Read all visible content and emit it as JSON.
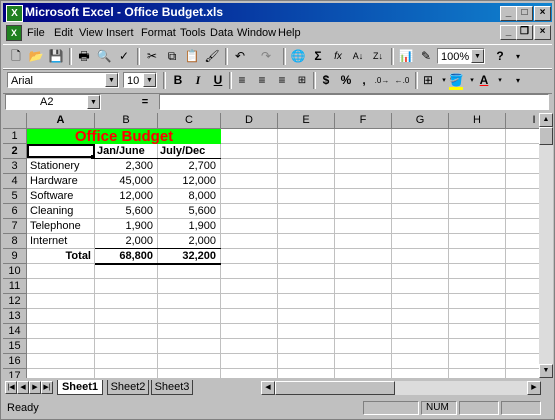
{
  "window": {
    "title": "Microsoft Excel - Office Budget.xls",
    "app_icon": "excel-icon",
    "doc_icon": "workbook-icon"
  },
  "menu": [
    "File",
    "Edit",
    "View",
    "Insert",
    "Format",
    "Tools",
    "Data",
    "Window",
    "Help"
  ],
  "toolbar": {
    "zoom": "100%",
    "font_name": "Arial",
    "font_size": "10",
    "bold_label": "B",
    "italic_label": "I",
    "underline_label": "U",
    "currency_label": "$",
    "percent_label": "%",
    "comma_label": ",",
    "sigma_label": "Σ",
    "fx_label": "fx",
    "help_label": "?",
    "font_color": "#ff0000",
    "fill_color": "#ffff00"
  },
  "formula_bar": {
    "name_box": "A2",
    "equals": "=",
    "content": ""
  },
  "columns": [
    "A",
    "B",
    "C",
    "D",
    "E",
    "F",
    "G",
    "H",
    "I"
  ],
  "rows": [
    "1",
    "2",
    "3",
    "4",
    "5",
    "6",
    "7",
    "8",
    "9",
    "10",
    "11",
    "12",
    "13",
    "14",
    "15",
    "16",
    "17"
  ],
  "sheet": {
    "title": "Office Budget",
    "title_color": "#ff0000",
    "title_bg": "#00ff00",
    "headers": [
      "Jan/June",
      "July/Dec"
    ],
    "items": [
      {
        "label": "Stationery",
        "h1": "2,300",
        "h2": "2,700"
      },
      {
        "label": "Hardware",
        "h1": "45,000",
        "h2": "12,000"
      },
      {
        "label": "Software",
        "h1": "12,000",
        "h2": "8,000"
      },
      {
        "label": "Cleaning",
        "h1": "5,600",
        "h2": "5,600"
      },
      {
        "label": "Telephone",
        "h1": "1,900",
        "h2": "1,900"
      },
      {
        "label": "Internet",
        "h1": "2,000",
        "h2": "2,000"
      }
    ],
    "total": {
      "label": "Total",
      "h1": "68,800",
      "h2": "32,200"
    }
  },
  "tabs": [
    "Sheet1",
    "Sheet2",
    "Sheet3"
  ],
  "status": {
    "ready": "Ready",
    "num": "NUM"
  }
}
